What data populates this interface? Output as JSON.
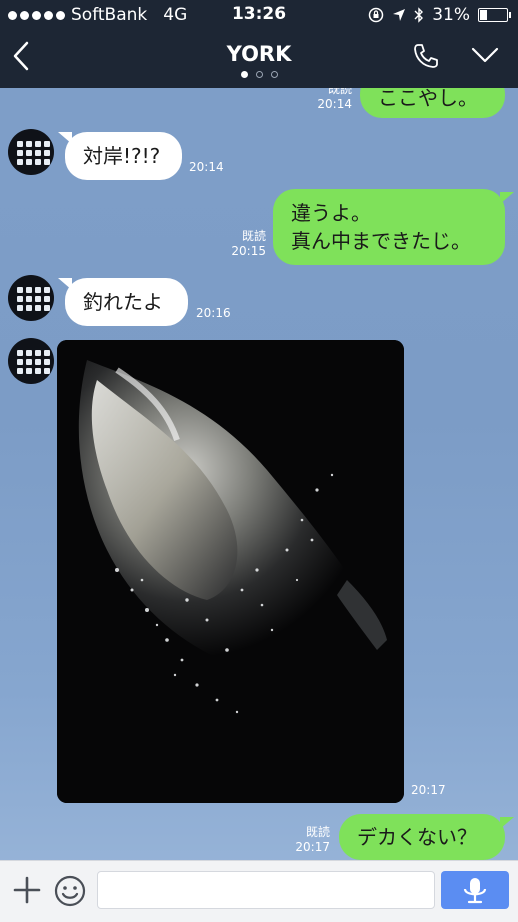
{
  "status_bar": {
    "carrier": "SoftBank",
    "network": "4G",
    "time": "13:26",
    "battery_text": "31%",
    "battery_level": 0.31
  },
  "header": {
    "title": "YORK",
    "page_count": 3,
    "active_page": 1
  },
  "messages": [
    {
      "side": "out",
      "text": "ここやし。",
      "read": "既読",
      "time": "20:14"
    },
    {
      "side": "in",
      "text": "対岸!?!?",
      "time": "20:14"
    },
    {
      "side": "out",
      "lines": [
        "違うよ。",
        "真ん中まできたじ。"
      ],
      "read": "既読",
      "time": "20:15"
    },
    {
      "side": "in",
      "text": "釣れたよ",
      "time": "20:16"
    },
    {
      "side": "in",
      "type": "photo",
      "time": "20:17"
    },
    {
      "side": "out",
      "text": "デカくない？",
      "read": "既読",
      "time": "20:17"
    }
  ],
  "input": {
    "value": "",
    "placeholder": ""
  },
  "colors": {
    "header_bg": "#1d2634",
    "outgoing_bubble": "#7fe15a",
    "incoming_bubble": "#ffffff",
    "mic_button": "#5b8df2",
    "chat_bg": "#7f9fc9"
  }
}
